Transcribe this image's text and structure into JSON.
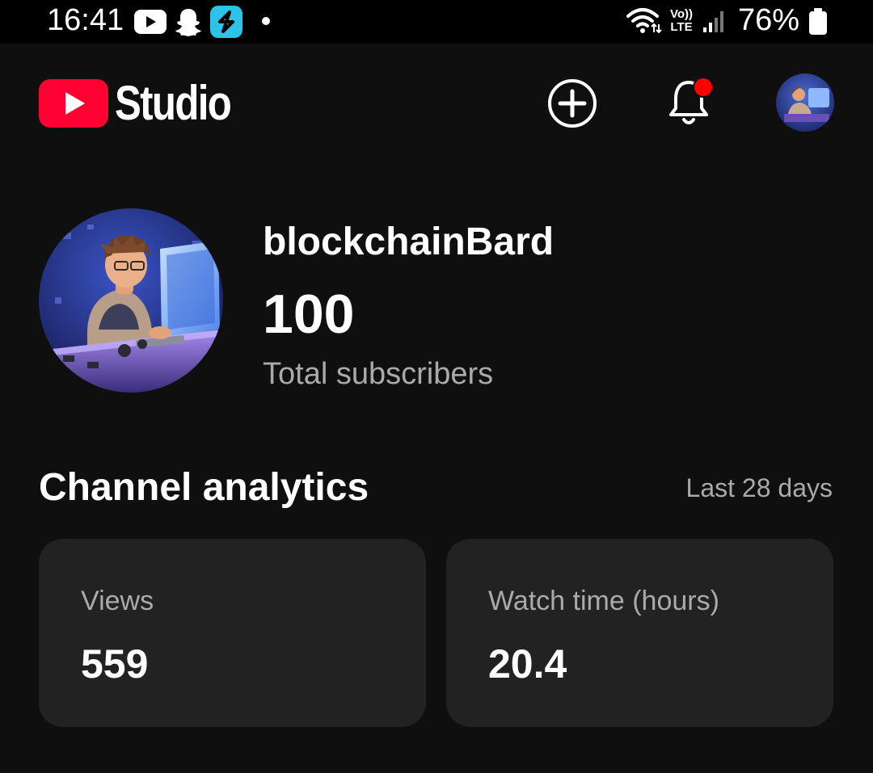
{
  "status_bar": {
    "time": "16:41",
    "battery_percent": "76%",
    "network_label_top": "Vo))",
    "network_label_bottom": "LTE",
    "notification_icons": [
      "youtube-icon",
      "snapchat-icon",
      "app-s-icon",
      "dot-icon"
    ]
  },
  "header": {
    "app_title": "Studio",
    "brand_color": "#ff0033",
    "notification_badge_color": "#ff0000"
  },
  "channel": {
    "name": "blockchainBard",
    "subscriber_count": "100",
    "subscriber_label": "Total subscribers"
  },
  "analytics": {
    "title": "Channel analytics",
    "period": "Last 28 days",
    "cards": [
      {
        "label": "Views",
        "value": "559"
      },
      {
        "label": "Watch time (hours)",
        "value": "20.4"
      }
    ]
  }
}
